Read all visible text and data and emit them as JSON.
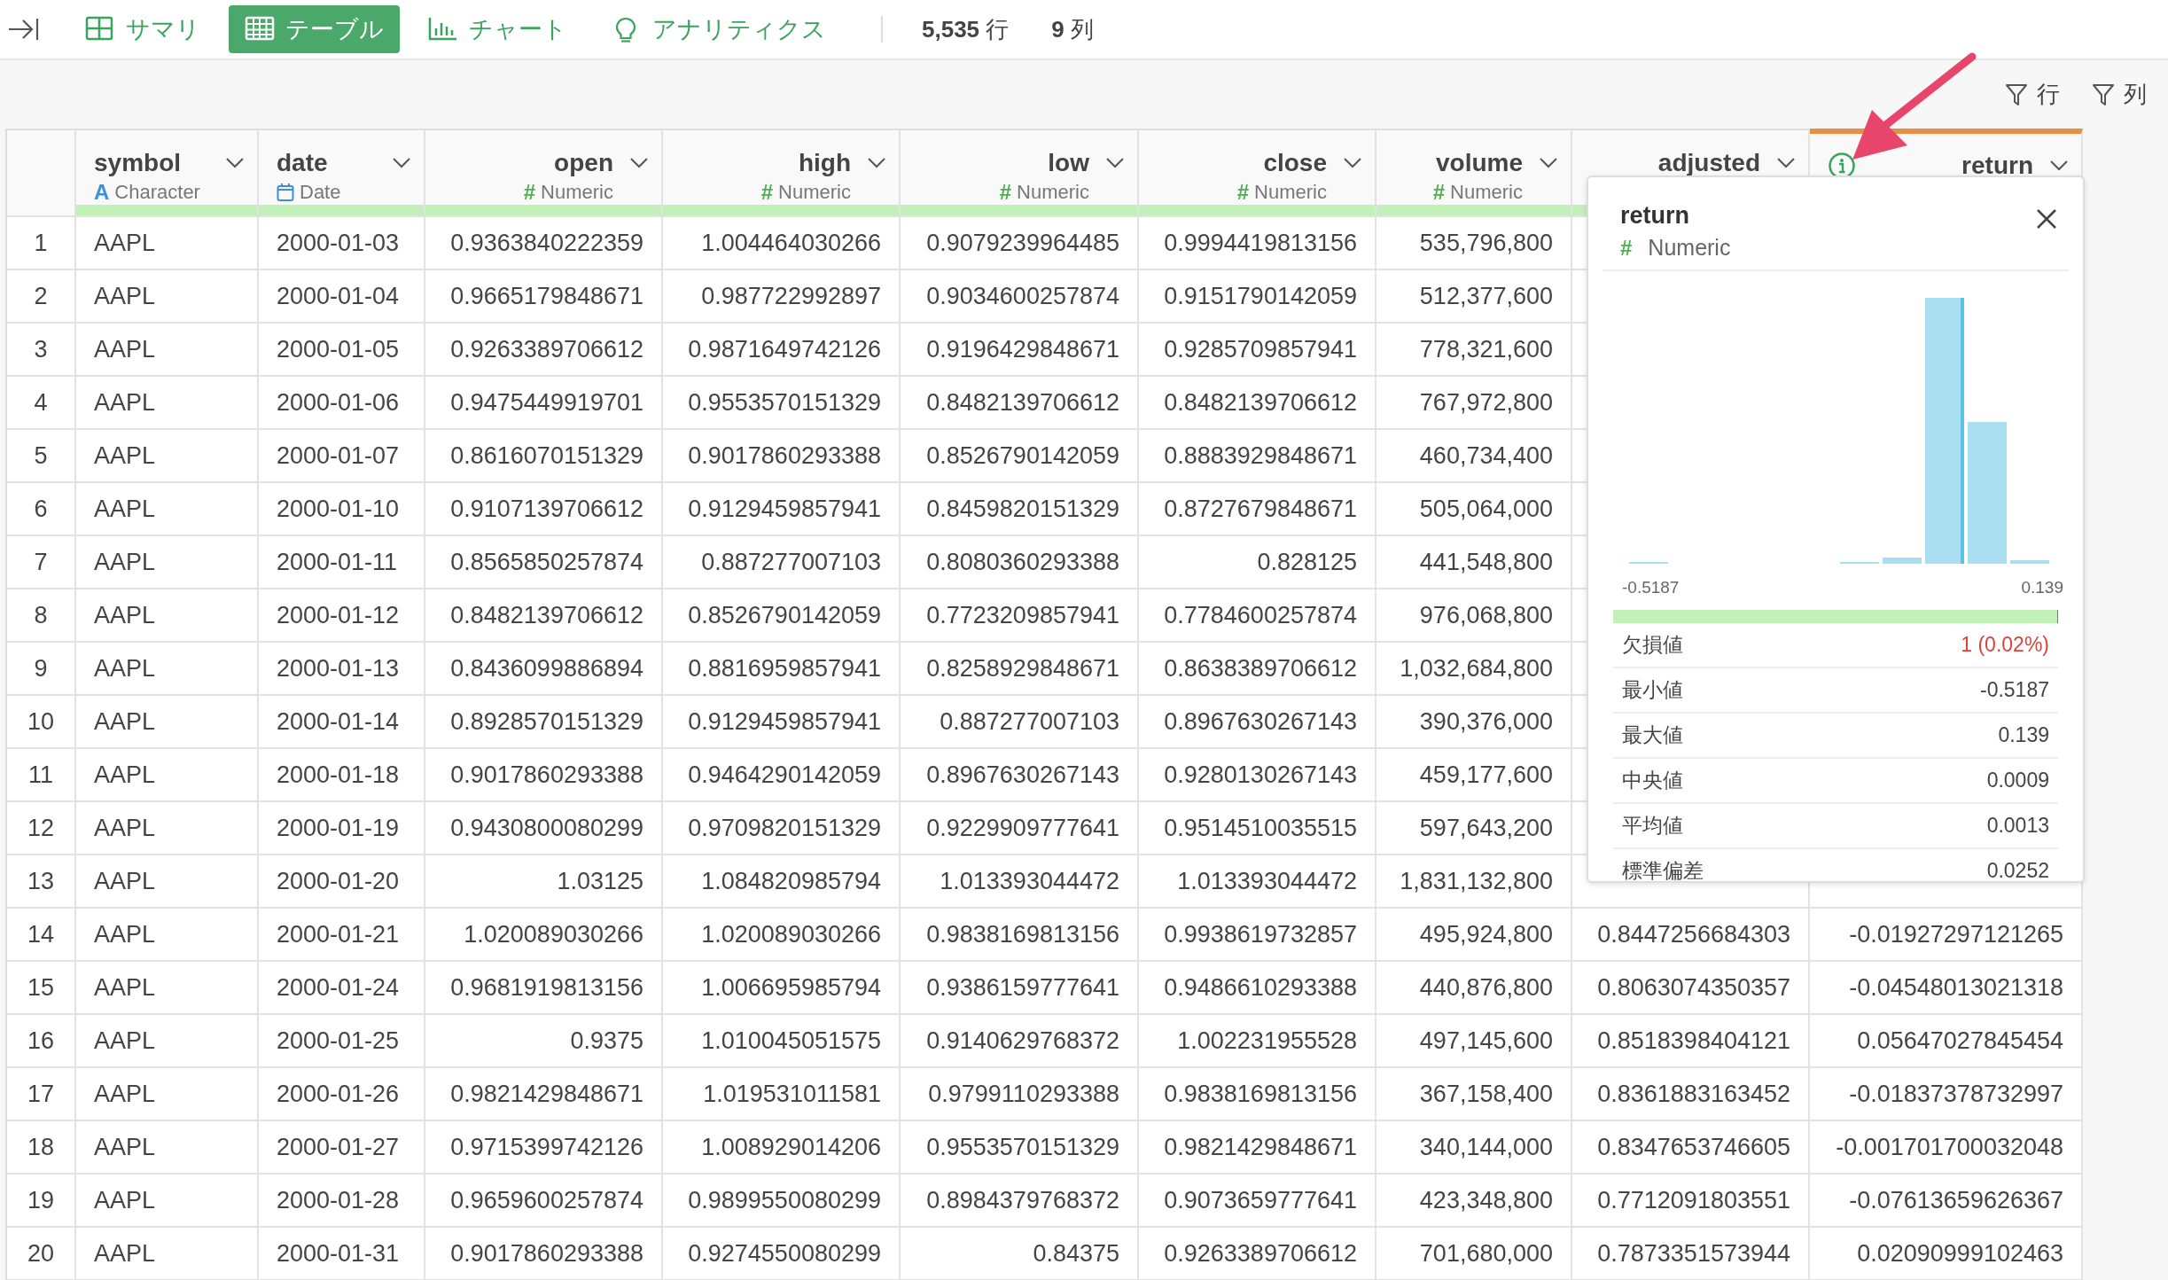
{
  "toolbar": {
    "tabs": [
      {
        "label": "サマリ",
        "selected": false
      },
      {
        "label": "テーブル",
        "selected": true
      },
      {
        "label": "チャート",
        "selected": false
      },
      {
        "label": "アナリティクス",
        "selected": false
      }
    ],
    "row_count": "**5,535** 行",
    "column_count": "**9** 列"
  },
  "filters": [
    {
      "label": "行"
    },
    {
      "label": "列"
    }
  ],
  "table": {
    "columns": [
      {
        "name": "symbol",
        "type": "Character",
        "mark": "A",
        "selected": false
      },
      {
        "name": "date",
        "type": "Date",
        "selected": false
      },
      {
        "name": "open",
        "type": "Numeric",
        "mark": "#",
        "selected": false
      },
      {
        "name": "high",
        "type": "Numeric",
        "mark": "#",
        "selected": false
      },
      {
        "name": "low",
        "type": "Numeric",
        "mark": "#",
        "selected": false
      },
      {
        "name": "close",
        "type": "Numeric",
        "mark": "#",
        "selected": false
      },
      {
        "name": "volume",
        "type": "Numeric",
        "mark": "#",
        "selected": false
      },
      {
        "name": "adjusted",
        "selected": false
      },
      {
        "name": "return",
        "selected": true
      }
    ],
    "rows": [
      {
        "number": "1",
        "cells": [
          "AAPL",
          "2000-01-03",
          "0.9363840222359",
          "1.004464030266",
          "0.9079239964485",
          "0.9994419813156",
          "535,796,800"
        ]
      },
      {
        "number": "2",
        "cells": [
          "AAPL",
          "2000-01-04",
          "0.9665179848671",
          "0.987722992897",
          "0.9034600257874",
          "0.9151790142059",
          "512,377,600"
        ]
      },
      {
        "number": "3",
        "cells": [
          "AAPL",
          "2000-01-05",
          "0.9263389706612",
          "0.9871649742126",
          "0.9196429848671",
          "0.9285709857941",
          "778,321,600"
        ]
      },
      {
        "number": "4",
        "cells": [
          "AAPL",
          "2000-01-06",
          "0.9475449919701",
          "0.9553570151329",
          "0.8482139706612",
          "0.8482139706612",
          "767,972,800"
        ]
      },
      {
        "number": "5",
        "cells": [
          "AAPL",
          "2000-01-07",
          "0.8616070151329",
          "0.9017860293388",
          "0.8526790142059",
          "0.8883929848671",
          "460,734,400"
        ]
      },
      {
        "number": "6",
        "cells": [
          "AAPL",
          "2000-01-10",
          "0.9107139706612",
          "0.9129459857941",
          "0.8459820151329",
          "0.8727679848671",
          "505,064,000"
        ]
      },
      {
        "number": "7",
        "cells": [
          "AAPL",
          "2000-01-11",
          "0.8565850257874",
          "0.887277007103",
          "0.8080360293388",
          "0.828125",
          "441,548,800"
        ]
      },
      {
        "number": "8",
        "cells": [
          "AAPL",
          "2000-01-12",
          "0.8482139706612",
          "0.8526790142059",
          "0.7723209857941",
          "0.7784600257874",
          "976,068,800"
        ]
      },
      {
        "number": "9",
        "cells": [
          "AAPL",
          "2000-01-13",
          "0.8436099886894",
          "0.8816959857941",
          "0.8258929848671",
          "0.8638389706612",
          "1,032,684,800"
        ]
      },
      {
        "number": "10",
        "cells": [
          "AAPL",
          "2000-01-14",
          "0.8928570151329",
          "0.9129459857941",
          "0.887277007103",
          "0.8967630267143",
          "390,376,000"
        ]
      },
      {
        "number": "11",
        "cells": [
          "AAPL",
          "2000-01-18",
          "0.9017860293388",
          "0.9464290142059",
          "0.8967630267143",
          "0.9280130267143",
          "459,177,600"
        ]
      },
      {
        "number": "12",
        "cells": [
          "AAPL",
          "2000-01-19",
          "0.9430800080299",
          "0.9709820151329",
          "0.9229909777641",
          "0.9514510035515",
          "597,643,200"
        ]
      },
      {
        "number": "13",
        "cells": [
          "AAPL",
          "2000-01-20",
          "1.03125",
          "1.084820985794",
          "1.013393044472",
          "1.013393044472",
          "1,831,132,800"
        ]
      },
      {
        "number": "14",
        "cells": [
          "AAPL",
          "2000-01-21",
          "1.020089030266",
          "1.020089030266",
          "0.9838169813156",
          "0.9938619732857",
          "495,924,800",
          "0.8447256684303",
          "-0.01927297121265"
        ]
      },
      {
        "number": "15",
        "cells": [
          "AAPL",
          "2000-01-24",
          "0.9681919813156",
          "1.006695985794",
          "0.9386159777641",
          "0.9486610293388",
          "440,876,800",
          "0.8063074350357",
          "-0.04548013021318"
        ]
      },
      {
        "number": "16",
        "cells": [
          "AAPL",
          "2000-01-25",
          "0.9375",
          "1.010045051575",
          "0.9140629768372",
          "1.002231955528",
          "497,145,600",
          "0.8518398404121",
          "0.05647027845454"
        ]
      },
      {
        "number": "17",
        "cells": [
          "AAPL",
          "2000-01-26",
          "0.9821429848671",
          "1.019531011581",
          "0.9799110293388",
          "0.9838169813156",
          "367,158,400",
          "0.8361883163452",
          "-0.01837378732997"
        ]
      },
      {
        "number": "18",
        "cells": [
          "AAPL",
          "2000-01-27",
          "0.9715399742126",
          "1.008929014206",
          "0.9553570151329",
          "0.9821429848671",
          "340,144,000",
          "0.8347653746605",
          "-0.001701700032048"
        ]
      },
      {
        "number": "19",
        "cells": [
          "AAPL",
          "2000-01-28",
          "0.9659600257874",
          "0.9899550080299",
          "0.8984379768372",
          "0.9073659777641",
          "423,348,800",
          "0.7712091803551",
          "-0.07613659626367"
        ]
      },
      {
        "number": "20",
        "cells": [
          "AAPL",
          "2000-01-31",
          "0.9017860293388",
          "0.9274550080299",
          "0.84375",
          "0.9263389706612",
          "701,680,000",
          "0.7873351573944",
          "0.02090999102463"
        ]
      }
    ]
  },
  "popup": {
    "title": "return",
    "type": "Numeric",
    "mark": "#",
    "histogram": {
      "min_label": "-0.5187",
      "max_label": "0.139"
    },
    "quality": {
      "level": 0.998
    },
    "stats": [
      {
        "label": "欠損値",
        "value": "1 (0.02%)",
        "warning": true
      },
      {
        "label": "最小値",
        "value": "-0.5187",
        "warning": false
      },
      {
        "label": "最大値",
        "value": "0.139",
        "warning": false
      },
      {
        "label": "中央値",
        "value": "0.0009",
        "warning": false
      },
      {
        "label": "平均値",
        "value": "0.0013",
        "warning": false
      },
      {
        "label": "標準偏差",
        "value": "0.0252",
        "warning": false
      }
    ]
  }
}
